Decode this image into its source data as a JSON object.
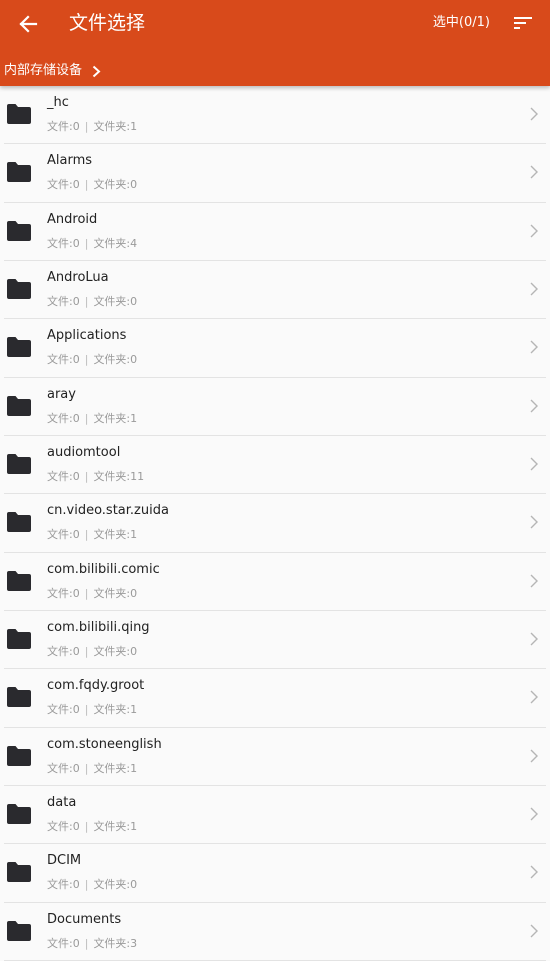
{
  "appbar": {
    "title": "文件选择",
    "selected": "选中(0/1)",
    "color": "#d84a1b",
    "back_icon": "arrow-left-icon",
    "sort_icon": "sort-icon"
  },
  "breadcrumb": {
    "label": "内部存储设备"
  },
  "folders": [
    {
      "name": "_hc",
      "files": "文件:0",
      "folders": "文件夹:1"
    },
    {
      "name": "Alarms",
      "files": "文件:0",
      "folders": "文件夹:0"
    },
    {
      "name": "Android",
      "files": "文件:0",
      "folders": "文件夹:4"
    },
    {
      "name": "AndroLua",
      "files": "文件:0",
      "folders": "文件夹:0"
    },
    {
      "name": "Applications",
      "files": "文件:0",
      "folders": "文件夹:0"
    },
    {
      "name": "aray",
      "files": "文件:0",
      "folders": "文件夹:1"
    },
    {
      "name": "audiomtool",
      "files": "文件:0",
      "folders": "文件夹:11"
    },
    {
      "name": "cn.video.star.zuida",
      "files": "文件:0",
      "folders": "文件夹:1"
    },
    {
      "name": "com.bilibili.comic",
      "files": "文件:0",
      "folders": "文件夹:0"
    },
    {
      "name": "com.bilibili.qing",
      "files": "文件:0",
      "folders": "文件夹:0"
    },
    {
      "name": "com.fqdy.groot",
      "files": "文件:0",
      "folders": "文件夹:1"
    },
    {
      "name": "com.stoneenglish",
      "files": "文件:0",
      "folders": "文件夹:1"
    },
    {
      "name": "data",
      "files": "文件:0",
      "folders": "文件夹:1"
    },
    {
      "name": "DCIM",
      "files": "文件:0",
      "folders": "文件夹:0"
    },
    {
      "name": "Documents",
      "files": "文件:0",
      "folders": "文件夹:3"
    }
  ],
  "meta_separator": "|"
}
